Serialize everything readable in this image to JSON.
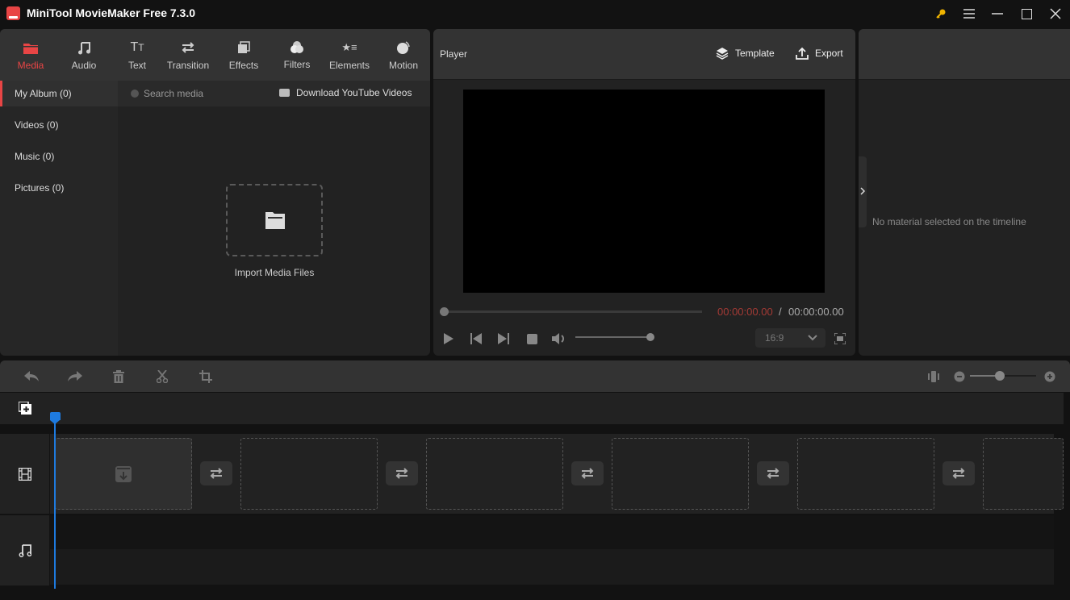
{
  "app": {
    "title": "MiniTool MovieMaker Free 7.3.0",
    "accent_color": "#e84545",
    "window_controls": [
      "key-icon",
      "menu-icon",
      "minimize-icon",
      "maximize-icon",
      "close-icon"
    ]
  },
  "toolbar": {
    "tabs": [
      {
        "label": "Media",
        "icon": "folder-icon",
        "active": true
      },
      {
        "label": "Audio",
        "icon": "music-note-icon",
        "active": false
      },
      {
        "label": "Text",
        "icon": "text-icon",
        "active": false
      },
      {
        "label": "Transition",
        "icon": "transition-arrows-icon",
        "active": false
      },
      {
        "label": "Effects",
        "icon": "effects-icon",
        "active": false
      },
      {
        "label": "Filters",
        "icon": "filters-icon",
        "active": false
      },
      {
        "label": "Elements",
        "icon": "elements-icon",
        "active": false
      },
      {
        "label": "Motion",
        "icon": "motion-icon",
        "active": false
      }
    ]
  },
  "media": {
    "sidebar": [
      {
        "label": "My Album (0)",
        "active": true
      },
      {
        "label": "Videos (0)",
        "active": false
      },
      {
        "label": "Music (0)",
        "active": false
      },
      {
        "label": "Pictures (0)",
        "active": false
      }
    ],
    "search_placeholder": "Search media",
    "download_label": "Download YouTube Videos",
    "import_label": "Import Media Files"
  },
  "player": {
    "title": "Player",
    "template_label": "Template",
    "export_label": "Export",
    "current_time": "00:00:00.00",
    "separator": "/",
    "total_time": "00:00:00.00",
    "progress": 0,
    "volume": 1.0,
    "aspect_ratio": "16:9"
  },
  "properties": {
    "empty_message": "No material selected on the timeline"
  },
  "timeline": {
    "tools": [
      "undo-icon",
      "redo-icon",
      "delete-icon",
      "split-icon",
      "crop-icon"
    ],
    "zoom_level": 0.45,
    "video_clip_slots": 6,
    "transition_slots": 5
  }
}
